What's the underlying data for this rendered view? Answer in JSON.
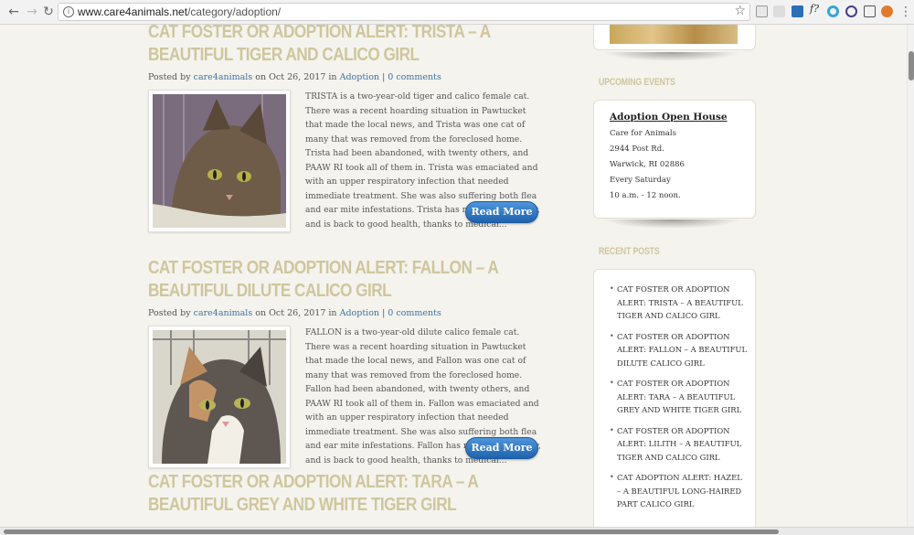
{
  "browser": {
    "url_host": "www.care4animals.net",
    "url_path": "/category/adoption/",
    "back_icon": "arrow-left-icon",
    "forward_icon": "arrow-right-icon",
    "reload_icon": "reload-icon"
  },
  "posts": [
    {
      "title": "CAT FOSTER OR ADOPTION ALERT: TRISTA – A BEAUTIFUL TIGER AND CALICO GIRL",
      "posted_by": "Posted by",
      "author": "care4animals",
      "on_date": "on Oct 26, 2017 in",
      "category": "Adoption",
      "separator": "|",
      "comments": "0 comments",
      "excerpt": "TRISTA is a two-year-old tiger and calico female cat. There was a recent hoarding situation in Pawtucket that made the local news, and Trista was one cat of many that was removed from the foreclosed home. Trista had been abandoned, with twenty others, and PAAW RI took all of them in. Trista was emaciated and with an upper respiratory infection that needed immediate treatment. She was also suffering both flea and ear mite infestations. Trista has recovered quickly, and is back to good health, thanks to medical...",
      "read_more": "Read More"
    },
    {
      "title": "CAT FOSTER OR ADOPTION ALERT: FALLON – A BEAUTIFUL DILUTE CALICO GIRL",
      "posted_by": "Posted by",
      "author": "care4animals",
      "on_date": "on Oct 26, 2017 in",
      "category": "Adoption",
      "separator": "|",
      "comments": "0 comments",
      "excerpt": "FALLON is a two-year-old dilute calico female cat. There was a recent hoarding situation in Pawtucket that made the local news, and Fallon was one cat of many that was removed from the foreclosed home. Fallon had been abandoned, with twenty others, and PAAW RI took all of them in. Fallon was emaciated and with an upper respiratory infection that needed immediate treatment. She was also suffering both flea and ear mite infestations. Fallon has recovered quickly, and is back to good health, thanks to medical...",
      "read_more": "Read More"
    },
    {
      "title": "CAT FOSTER OR ADOPTION ALERT: TARA – A BEAUTIFUL GREY AND WHITE TIGER GIRL"
    }
  ],
  "sidebar": {
    "events_heading": "UPCOMING EVENTS",
    "event": {
      "title": "Adoption Open House",
      "lines": [
        "Care for Animals",
        "2944 Post Rd.",
        "Warwick, RI 02886",
        "Every Saturday",
        "10 a.m. - 12 noon."
      ]
    },
    "recent_heading": "RECENT POSTS",
    "recent_posts": [
      "CAT FOSTER OR ADOPTION ALERT: TRISTA – A BEAUTIFUL TIGER AND CALICO GIRL",
      "CAT FOSTER OR ADOPTION ALERT: FALLON – A BEAUTIFUL DILUTE CALICO GIRL",
      "CAT FOSTER OR ADOPTION ALERT: TARA – A BEAUTIFUL GREY AND WHITE TIGER GIRL",
      "CAT FOSTER OR ADOPTION ALERT: LILITH – A BEAUTIFUL TIGER AND CALICO GIRL",
      "CAT ADOPTION ALERT: HAZEL – A BEAUTIFUL LONG-HAIRED PART CALICO GIRL"
    ]
  },
  "colors": {
    "title": "#cfc69d",
    "link": "#3f72a3",
    "button": "#2a72c0",
    "background": "#f4f3ee"
  }
}
